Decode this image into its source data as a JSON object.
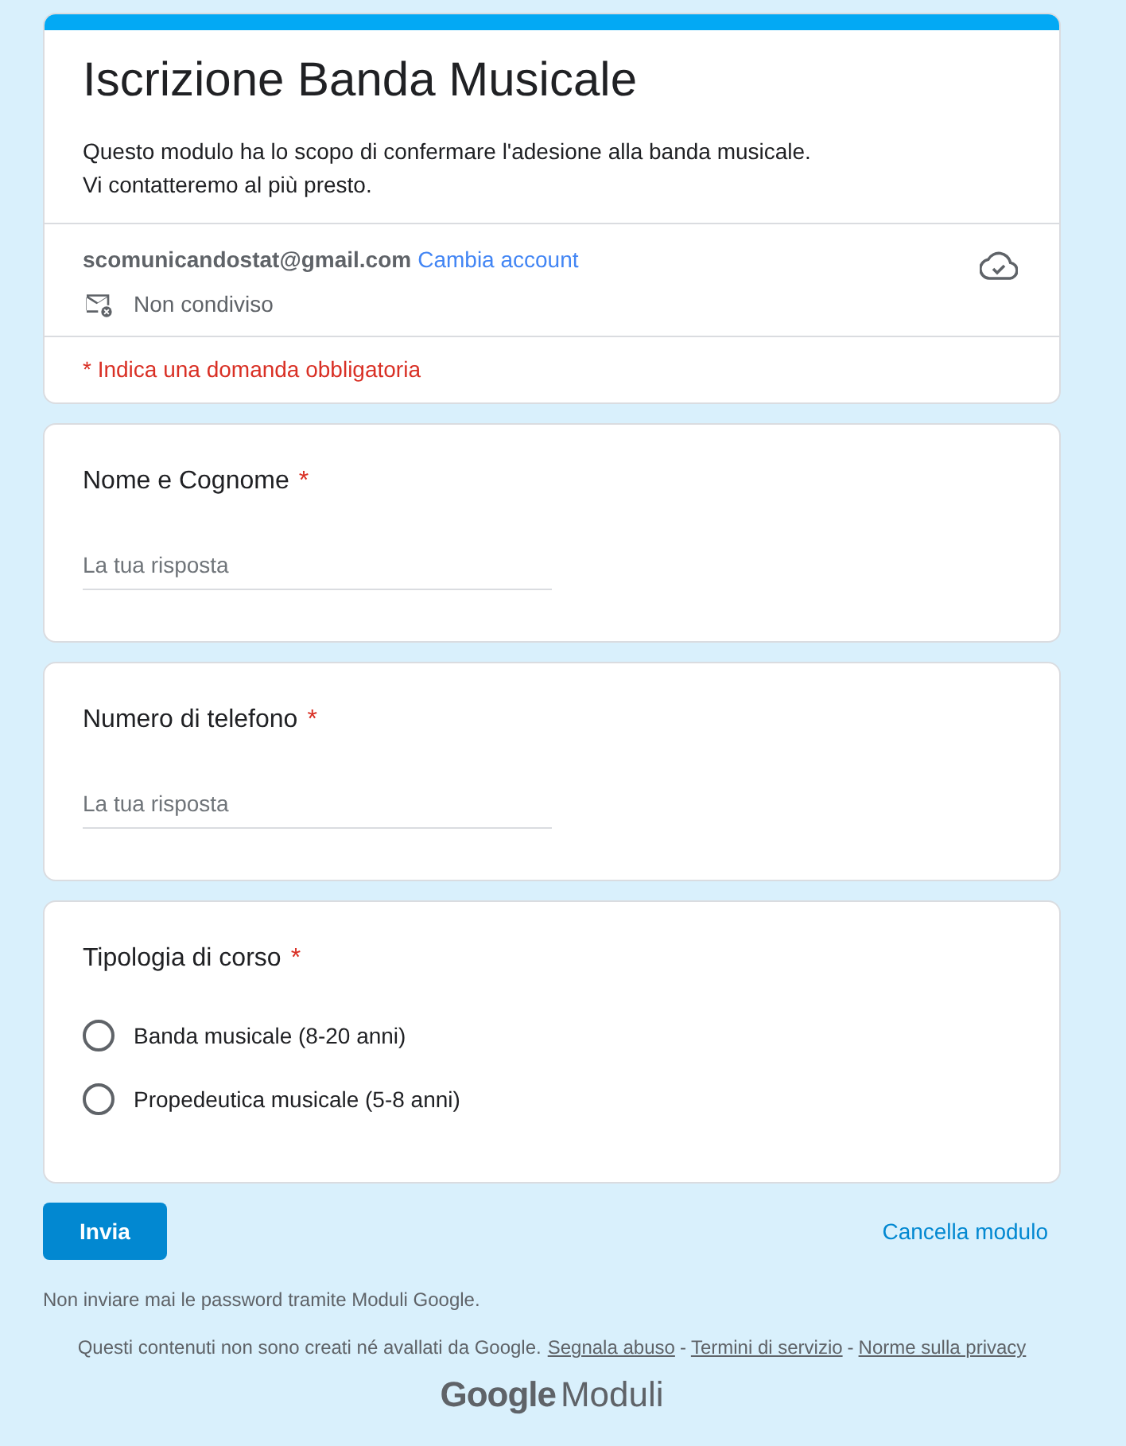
{
  "form": {
    "title": "Iscrizione Banda Musicale",
    "description": [
      "Questo modulo ha lo scopo di confermare l'adesione alla banda musicale.",
      "Vi contatteremo al più presto."
    ]
  },
  "account": {
    "email": "scomunicandostat@gmail.com",
    "switch_link": "Cambia account",
    "sharing": "Non condiviso"
  },
  "required_note": "* Indica una domanda obbligatoria",
  "questions": [
    {
      "kind": "text",
      "title": "Nome e Cognome",
      "required_mark": "*",
      "placeholder": "La tua risposta"
    },
    {
      "kind": "text",
      "title": "Numero di telefono",
      "required_mark": "*",
      "placeholder": "La tua risposta"
    },
    {
      "kind": "radio",
      "title": "Tipologia di corso",
      "required_mark": "*",
      "options": [
        {
          "label": "Banda musicale (8-20 anni)",
          "selected": false
        },
        {
          "label": "Propedeutica musicale (5-8 anni)",
          "selected": false
        }
      ]
    }
  ],
  "submit_button": "Invia",
  "clear_link": "Cancella modulo",
  "footer": {
    "warning": "Non inviare mai le password tramite Moduli Google.",
    "disclaimer": "Questi contenuti non sono creati né avallati da Google.",
    "links": [
      "Segnala abuso",
      "Termini di servizio",
      "Norme sulla privacy"
    ],
    "separator": "-",
    "logo": {
      "brand": "Google",
      "product": "Moduli"
    }
  }
}
